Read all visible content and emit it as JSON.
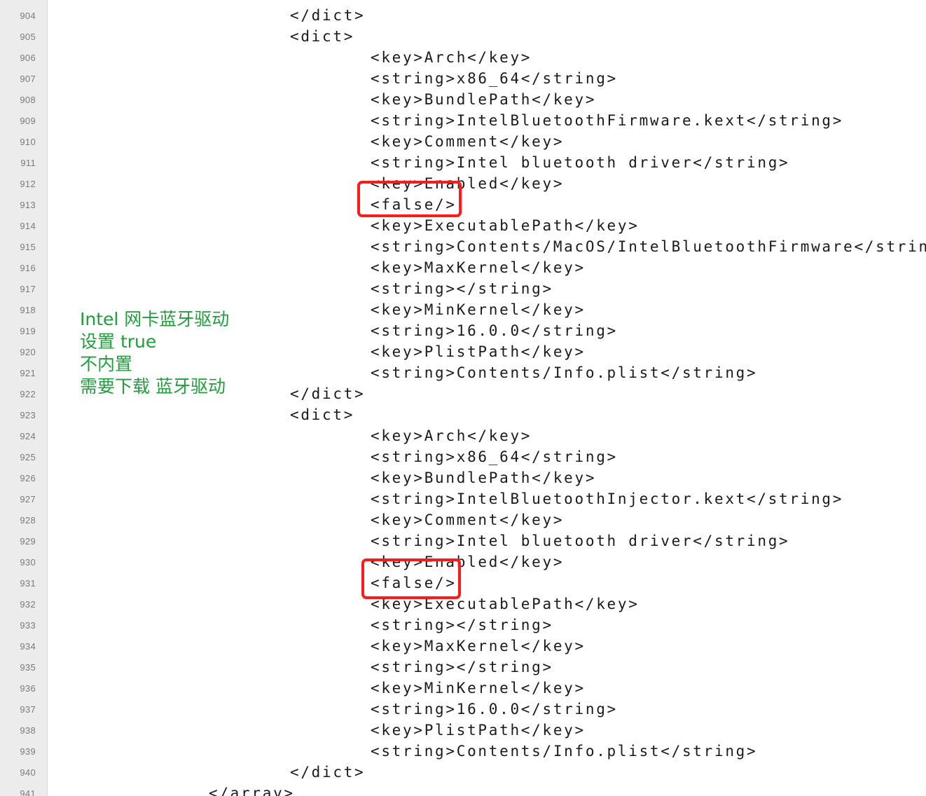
{
  "editor": {
    "lines": [
      {
        "num": "904",
        "text": "</dict>"
      },
      {
        "num": "905",
        "text": "<dict>"
      },
      {
        "num": "906",
        "text": "<key>Arch</key>"
      },
      {
        "num": "907",
        "text": "<string>x86_64</string>"
      },
      {
        "num": "908",
        "text": "<key>BundlePath</key>"
      },
      {
        "num": "909",
        "text": "<string>IntelBluetoothFirmware.kext</string>"
      },
      {
        "num": "910",
        "text": "<key>Comment</key>"
      },
      {
        "num": "911",
        "text": "<string>Intel bluetooth driver</string>"
      },
      {
        "num": "912",
        "text": "<key>Enabled</key>"
      },
      {
        "num": "913",
        "text": "<false/>"
      },
      {
        "num": "914",
        "text": "<key>ExecutablePath</key>"
      },
      {
        "num": "915",
        "text": "<string>Contents/MacOS/IntelBluetoothFirmware</string>"
      },
      {
        "num": "916",
        "text": "<key>MaxKernel</key>"
      },
      {
        "num": "917",
        "text": "<string></string>"
      },
      {
        "num": "918",
        "text": "<key>MinKernel</key>"
      },
      {
        "num": "919",
        "text": "<string>16.0.0</string>"
      },
      {
        "num": "920",
        "text": "<key>PlistPath</key>"
      },
      {
        "num": "921",
        "text": "<string>Contents/Info.plist</string>"
      },
      {
        "num": "922",
        "text": "</dict>"
      },
      {
        "num": "923",
        "text": "<dict>"
      },
      {
        "num": "924",
        "text": "<key>Arch</key>"
      },
      {
        "num": "925",
        "text": "<string>x86_64</string>"
      },
      {
        "num": "926",
        "text": "<key>BundlePath</key>"
      },
      {
        "num": "927",
        "text": "<string>IntelBluetoothInjector.kext</string>"
      },
      {
        "num": "928",
        "text": "<key>Comment</key>"
      },
      {
        "num": "929",
        "text": "<string>Intel bluetooth driver</string>"
      },
      {
        "num": "930",
        "text": "<key>Enabled</key>"
      },
      {
        "num": "931",
        "text": "<false/>"
      },
      {
        "num": "932",
        "text": "<key>ExecutablePath</key>"
      },
      {
        "num": "933",
        "text": "<string></string>"
      },
      {
        "num": "934",
        "text": "<key>MaxKernel</key>"
      },
      {
        "num": "935",
        "text": "<string></string>"
      },
      {
        "num": "936",
        "text": "<key>MinKernel</key>"
      },
      {
        "num": "937",
        "text": "<string>16.0.0</string>"
      },
      {
        "num": "938",
        "text": "<key>PlistPath</key>"
      },
      {
        "num": "939",
        "text": "<string>Contents/Info.plist</string>"
      },
      {
        "num": "940",
        "text": "</dict>"
      },
      {
        "num": "941",
        "text": "</array>"
      }
    ]
  },
  "annotation": {
    "lines": [
      "Intel 网卡蓝牙驱动",
      "设置 true",
      "不内置",
      "需要下载 蓝牙驱动"
    ],
    "color": "#1f9e3c"
  },
  "highlight_color": "#ff1a1a"
}
